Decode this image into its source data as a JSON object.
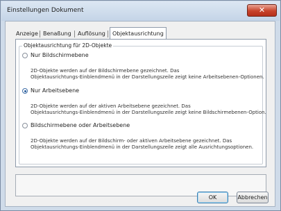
{
  "window": {
    "title": "Einstellungen Dokument"
  },
  "tabs": [
    {
      "label": "Anzeige",
      "active": false
    },
    {
      "label": "Benaßung",
      "active": false
    },
    {
      "label": "Auflösung",
      "active": false
    },
    {
      "label": "Objektausrichtung",
      "active": true
    }
  ],
  "group": {
    "legend": "Objektausrichtung für 2D-Objekte",
    "options": [
      {
        "label": "Nur Bildschirmebene",
        "selected": false,
        "description": [
          "2D-Objekte werden auf der Bildschirmebene gezeichnet. Das",
          "Objektausrichtungs-Einblendmenü in der Darstellungszeile zeigt keine Arbeitsebenen-Optionen."
        ]
      },
      {
        "label": "Nur Arbeitsebene",
        "selected": true,
        "description": [
          "2D-Objekte werden auf der aktiven Arbeitsebene gezeichnet. Das",
          "Objektausrichtungs-Einblendmenü in der Darstellungszeile zeigt keine Bildschirmebenen-Option."
        ]
      },
      {
        "label": "Bildschirmebene oder Arbeitsebene",
        "selected": false,
        "description": [
          "2D-Objekte werden auf der Bildschirm- oder aktiven Arbeitsebene gezeichnet. Das",
          "Objektausrichtungs-Einblendmenü in der Darstellungszeile zeigt alle Ausrichtungsoptionen."
        ]
      }
    ]
  },
  "buttons": {
    "ok": "OK",
    "cancel": "Abbrechen",
    "close_glyph": "✕"
  }
}
